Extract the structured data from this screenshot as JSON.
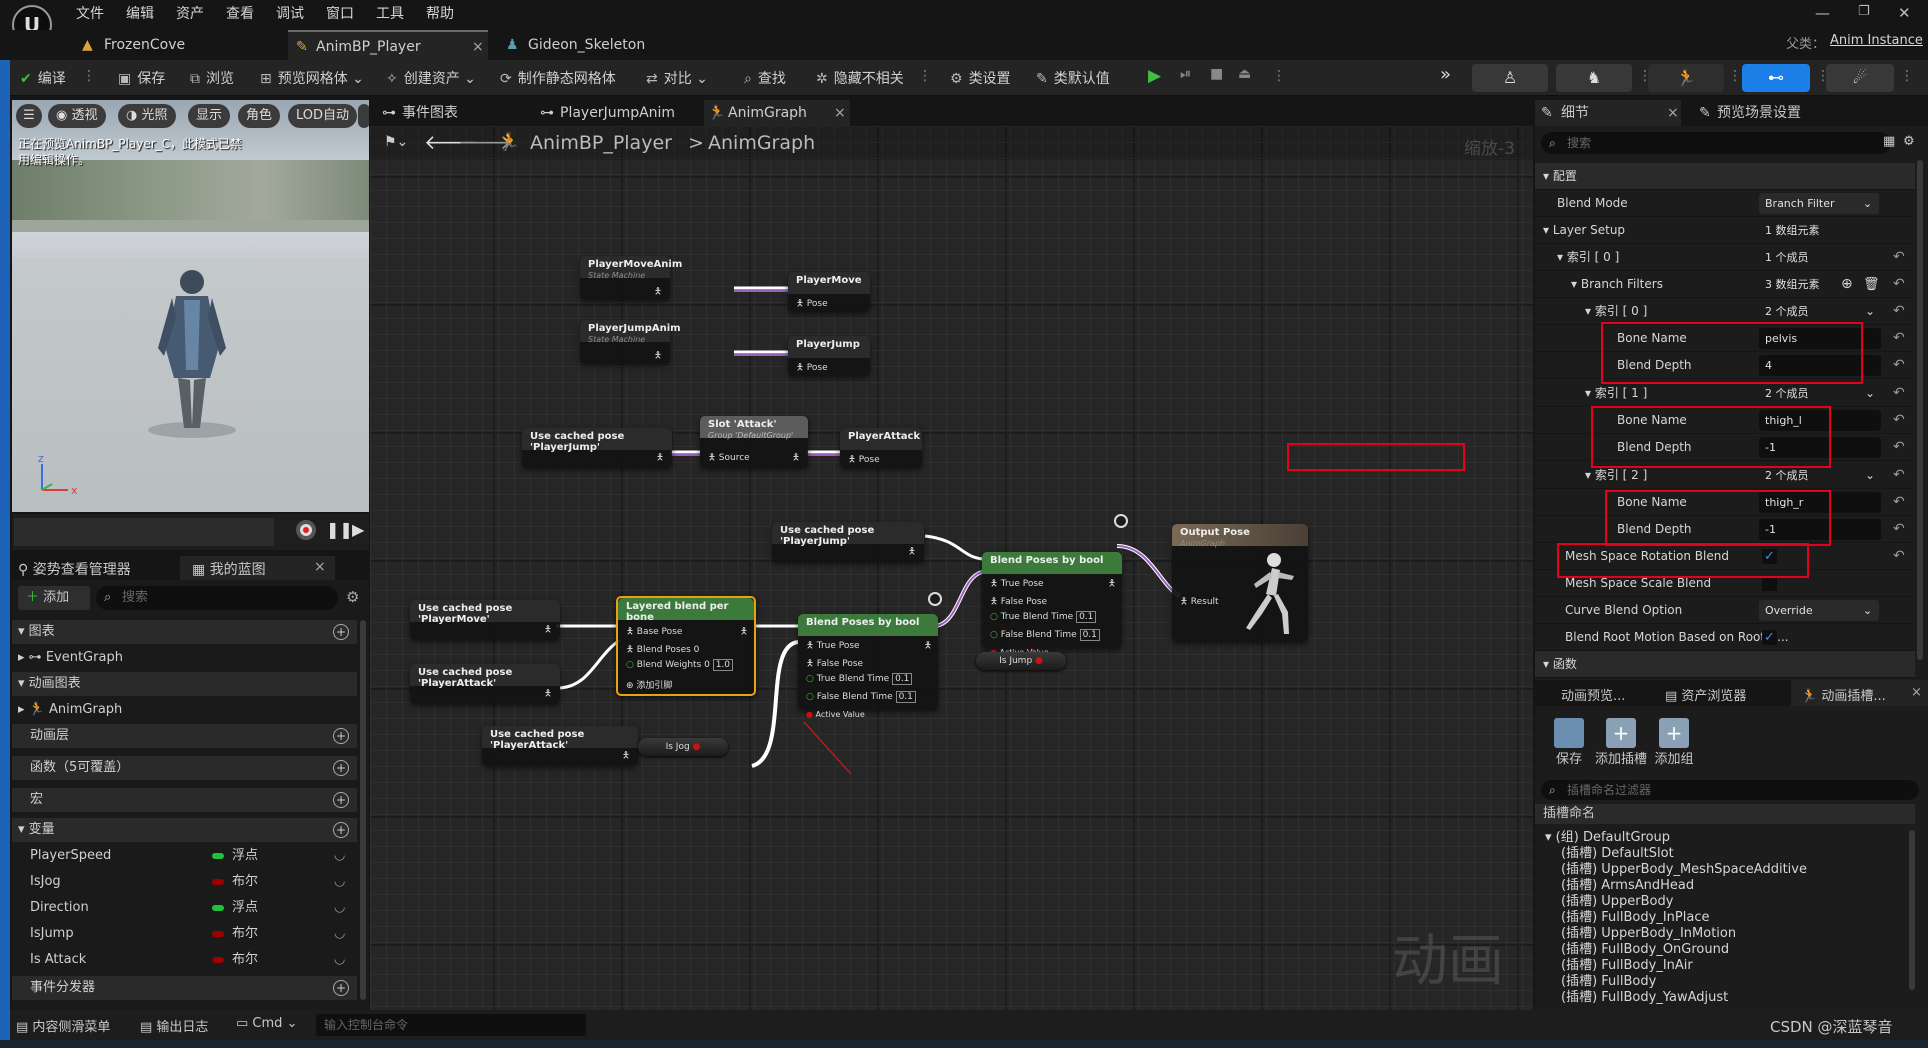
{
  "menu": {
    "items": [
      "文件",
      "编辑",
      "资产",
      "查看",
      "调试",
      "窗口",
      "工具",
      "帮助"
    ]
  },
  "tabs": {
    "items": [
      "FrozenCove",
      "AnimBP_Player",
      "Gideon_Skeleton"
    ],
    "parent_label": "父类：",
    "parent_value": "Anim Instance"
  },
  "toolbar": {
    "compile": "编译",
    "save": "保存",
    "browse": "浏览",
    "preview_mesh": "预览网格体",
    "create_asset": "创建资产",
    "make_static_mesh": "制作静态网格体",
    "diff": "对比",
    "find": "查找",
    "hide_unrelated": "隐藏不相关",
    "class_settings": "类设置",
    "class_defaults": "类默认值"
  },
  "viewport": {
    "perspective": "透视",
    "lit": "光照",
    "show": "显示",
    "character": "角色",
    "lod": "LOD自动",
    "warning": "正在预览AnimBP_Player_C，此模式已禁用编辑操作。",
    "axis_z": "z",
    "axis_x": "x"
  },
  "left_panel": {
    "tab_pose": "姿势查看管理器",
    "tab_blueprint": "我的蓝图",
    "add": "添加",
    "search_placeholder": "搜索",
    "sections": {
      "graphs": "图表",
      "eventgraph": "EventGraph",
      "anim_graphs": "动画图表",
      "animgraph": "AnimGraph",
      "anim_layers": "动画层",
      "functions": "函数（5可覆盖）",
      "macros": "宏",
      "variables": "变量",
      "dispatchers": "事件分发器"
    },
    "variables": [
      {
        "name": "PlayerSpeed",
        "type": "浮点",
        "color": "#22c13d"
      },
      {
        "name": "IsJog",
        "type": "布尔",
        "color": "#9d0000"
      },
      {
        "name": "Direction",
        "type": "浮点",
        "color": "#22c13d"
      },
      {
        "name": "IsJump",
        "type": "布尔",
        "color": "#9d0000"
      },
      {
        "name": "Is Attack",
        "type": "布尔",
        "color": "#9d0000"
      }
    ]
  },
  "graph_tabs": {
    "items": [
      "事件图表",
      "PlayerJumpAnim",
      "AnimGraph"
    ]
  },
  "breadcrumb": {
    "root": "AnimBP_Player",
    "sep": ">",
    "leaf": "AnimGraph",
    "zoom": "缩放-3"
  },
  "nodes": {
    "pma": {
      "title": "PlayerMoveAnim",
      "sub": "State Machine"
    },
    "pm": {
      "title": "PlayerMove",
      "pin": "Pose"
    },
    "pja": {
      "title": "PlayerJumpAnim",
      "sub": "State Machine"
    },
    "pj": {
      "title": "PlayerJump",
      "pin": "Pose"
    },
    "ucj1": {
      "title": "Use cached pose 'PlayerJump'"
    },
    "slot": {
      "title": "Slot 'Attack'",
      "sub": "Group 'DefaultGroup'",
      "pin": "Source"
    },
    "pa": {
      "title": "PlayerAttack",
      "pin": "Pose"
    },
    "ucj2": {
      "title": "Use cached pose 'PlayerJump'"
    },
    "ucm": {
      "title": "Use cached pose 'PlayerMove'"
    },
    "uca1": {
      "title": "Use cached pose 'PlayerAttack'"
    },
    "lbpb": {
      "title": "Layered blend per bone",
      "base": "Base Pose",
      "bp0": "Blend Poses 0",
      "bw0": "Blend Weights 0",
      "bw0v": "1.0",
      "addpin": "添加引脚"
    },
    "bpb1": {
      "title": "Blend Poses by bool",
      "tp": "True Pose",
      "fp": "False Pose",
      "tbt": "True Blend Time",
      "tbtv": "0.1",
      "fbt": "False Blend Time",
      "fbtv": "0.1",
      "av": "Active Value"
    },
    "bpb2": {
      "title": "Blend Poses by bool",
      "tp": "True Pose",
      "fp": "False Pose",
      "tbt": "True Blend Time",
      "tbtv": "0.1",
      "fbt": "False Blend Time",
      "fbtv": "0.1",
      "av": "Active Value"
    },
    "out": {
      "title": "Output Pose",
      "sub": "AnimGraph",
      "pin": "Result"
    },
    "uca2": {
      "title": "Use cached pose 'PlayerAttack'"
    },
    "isjog": {
      "title": "Is Jog"
    },
    "isjump": {
      "title": "Is Jump"
    },
    "watermark": "动画"
  },
  "details": {
    "tab_details": "细节",
    "tab_preview": "预览场景设置",
    "search_placeholder": "搜索",
    "cat_config": "配置",
    "blend_mode": "Blend Mode",
    "blend_mode_val": "Branch Filter",
    "layer_setup": "Layer Setup",
    "layer_setup_val": "1 数组元素",
    "idx0": "索引 [ 0 ]",
    "idx0_val": "1 个成员",
    "branch_filters": "Branch Filters",
    "branch_filters_val": "3 数组元素",
    "bf": [
      {
        "idx": "索引 [ 0 ]",
        "val": "2 个成员",
        "bone": "pelvis",
        "depth": "4"
      },
      {
        "idx": "索引 [ 1 ]",
        "val": "2 个成员",
        "bone": "thigh_l",
        "depth": "-1"
      },
      {
        "idx": "索引 [ 2 ]",
        "val": "2 个成员",
        "bone": "thigh_r",
        "depth": "-1"
      }
    ],
    "bone_name": "Bone Name",
    "blend_depth": "Blend Depth",
    "msrb": "Mesh Space Rotation Blend",
    "mssb": "Mesh Space Scale Blend",
    "cbo": "Curve Blend Option",
    "cbo_val": "Override",
    "brm": "Blend Root Motion Based on Root B...",
    "cat_func": "函数"
  },
  "slots_panel": {
    "tab1": "动画预览...",
    "tab2": "资产浏览器",
    "tab3": "动画插槽...",
    "save": "保存",
    "add_slot": "添加插槽",
    "add_group": "添加组",
    "filter_placeholder": "插槽命名过滤器",
    "header": "插槽命名",
    "items": [
      "(组) DefaultGroup",
      "(插槽) DefaultSlot",
      "(插槽) UpperBody_MeshSpaceAdditive",
      "(插槽) ArmsAndHead",
      "(插槽) UpperBody",
      "(插槽) FullBody_InPlace",
      "(插槽) UpperBody_InMotion",
      "(插槽) FullBody_OnGround",
      "(插槽) FullBody_InAir",
      "(插槽) FullBody",
      "(插槽) FullBody_YawAdjust"
    ]
  },
  "statusbar": {
    "content_drawer": "内容侧滑菜单",
    "output_log": "输出日志",
    "cmd": "Cmd",
    "console_placeholder": "输入控制台命令",
    "credit": "CSDN @深蓝琴音"
  }
}
